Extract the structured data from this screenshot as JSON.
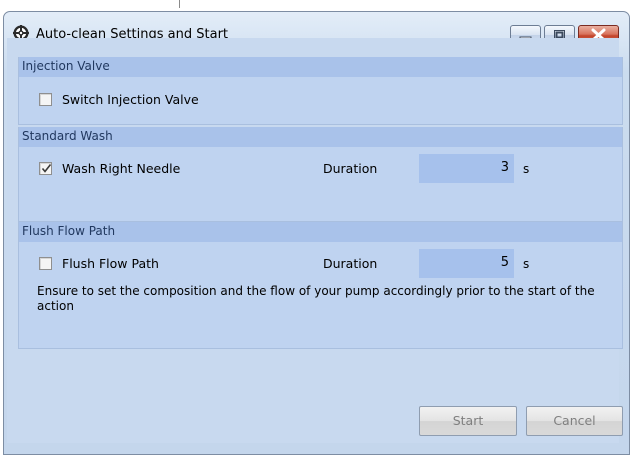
{
  "window": {
    "title": "Auto-clean Settings and Start",
    "icon": "gear-icon",
    "controls": [
      "minimize-icon",
      "maximize-icon",
      "close-icon"
    ]
  },
  "injection_valve": {
    "header": "Injection Valve",
    "switch_label": "Switch Injection Valve",
    "switch_checked": false
  },
  "standard_wash": {
    "header": "Standard Wash",
    "wash_label": "Wash Right Needle",
    "wash_checked": true,
    "duration_label": "Duration",
    "duration_value": "3",
    "duration_unit": "s"
  },
  "flush_flow_path": {
    "header": "Flush Flow Path",
    "flush_label": "Flush Flow Path",
    "flush_checked": false,
    "duration_label": "Duration",
    "duration_value": "5",
    "duration_unit": "s",
    "note": "Ensure to set the composition and the flow of your pump accordingly prior to the start of the action"
  },
  "buttons": {
    "start": "Start",
    "cancel": "Cancel"
  },
  "colors": {
    "group_header_bg": "#a9c2ea",
    "group_body_bg": "#bfd3f0",
    "input_bg": "#a6c1ec",
    "close_button": "#c2432a"
  }
}
